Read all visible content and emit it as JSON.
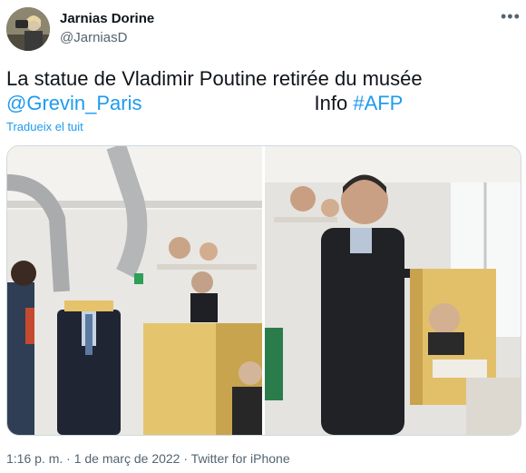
{
  "author": {
    "display_name": "Jarnias Dorine",
    "handle": "@JarniasD",
    "avatar_icon": "user-avatar-photo"
  },
  "menu_icon": "more-dots-icon",
  "tweet": {
    "line1": "La statue de Vladimir Poutine retirée du musée",
    "mention": "@Grevin_Paris",
    "info_label": "Info",
    "hashtag": "#AFP",
    "translate_label": "Tradueix el tuit"
  },
  "media": {
    "photo_count": 2
  },
  "meta": {
    "time": "1:16 p. m.",
    "separator1": "·",
    "date": "1 de març de 2022",
    "separator2": "·",
    "source": "Twitter for iPhone"
  },
  "colors": {
    "link": "#1d9bf0",
    "secondary_text": "#536471",
    "border": "#cfd9de"
  }
}
